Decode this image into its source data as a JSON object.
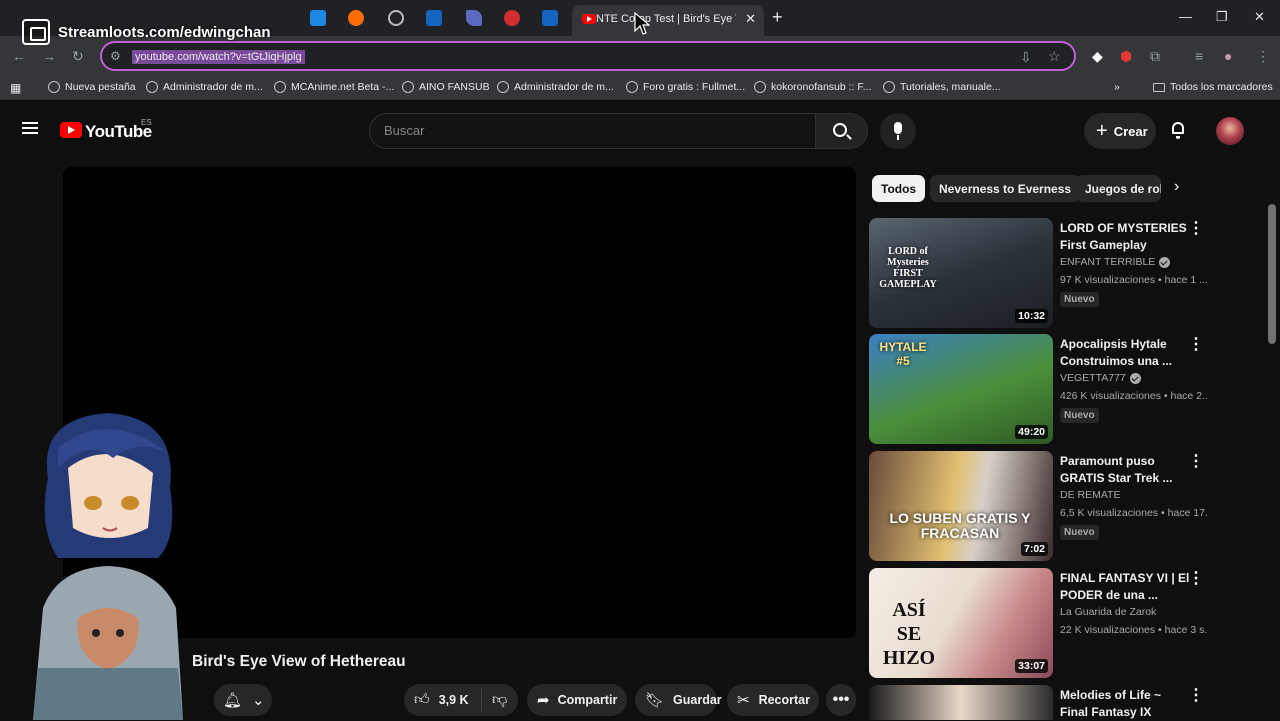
{
  "overlay": {
    "streamloots": "Streamloots.com/edwingchan"
  },
  "browser": {
    "active_tab_title": "NTE Co-op Test | Bird's Eye View",
    "url": "youtube.com/watch?v=tGtJiqHjplg",
    "bookmarks": [
      "Nueva pestaña",
      "Administrador de m...",
      "MCAnime.net Beta -...",
      "AINO FANSUB",
      "Administrador de m...",
      "Foro gratis : Fullmet...",
      "kokoronofansub :: F...",
      "Tutoriales, manuale..."
    ],
    "all_bookmarks": "Todos los marcadores"
  },
  "youtube": {
    "logo": "YouTube",
    "region": "ES",
    "search_placeholder": "Buscar",
    "create_label": "Crear",
    "video_title": "Bird's Eye View of Hethereau",
    "likes": "3,9 K",
    "share_label": "Compartir",
    "save_label": "Guardar",
    "clip_label": "Recortar",
    "chips": [
      "Todos",
      "Neverness to Everness",
      "Juegos de rol"
    ],
    "recommendations": [
      {
        "title": "LORD OF MYSTERIES First Gameplay Revea...",
        "channel": "ENFANT TERRIBLE",
        "verified": true,
        "meta": "97 K visualizaciones • hace 1 ...",
        "badge": "Nuevo",
        "duration": "10:32",
        "thumb_text": "LORD of Mysteries FIRST GAMEPLAY"
      },
      {
        "title": "Apocalipsis Hytale Construimos una ...",
        "channel": "VEGETTA777",
        "verified": true,
        "meta": "426 K visualizaciones • hace 2...",
        "badge": "Nuevo",
        "duration": "49:20",
        "thumb_text": "HYTALE #5"
      },
      {
        "title": "Paramount puso GRATIS Star Trek ...",
        "channel": "DE REMATE",
        "verified": false,
        "meta": "6,5 K visualizaciones • hace 17...",
        "badge": "Nuevo",
        "duration": "7:02",
        "thumb_text": "LO SUBEN GRATIS Y FRACASAN"
      },
      {
        "title": "FINAL FANTASY VI | El PODER de una ...",
        "channel": "La Guarida de Zarok",
        "verified": false,
        "meta": "22 K visualizaciones • hace 3 s...",
        "badge": "",
        "duration": "33:07",
        "thumb_text": "ASÍ SE HIZO"
      },
      {
        "title": "Melodies of Life ~ Final Fantasy IX (Japanese ...",
        "channel": "",
        "verified": false,
        "meta": "",
        "badge": "",
        "duration": "",
        "thumb_text": ""
      }
    ]
  },
  "colors": {
    "accent": "#ff0000",
    "url_border": "#c25ed6",
    "bg": "#0f0f0f"
  }
}
